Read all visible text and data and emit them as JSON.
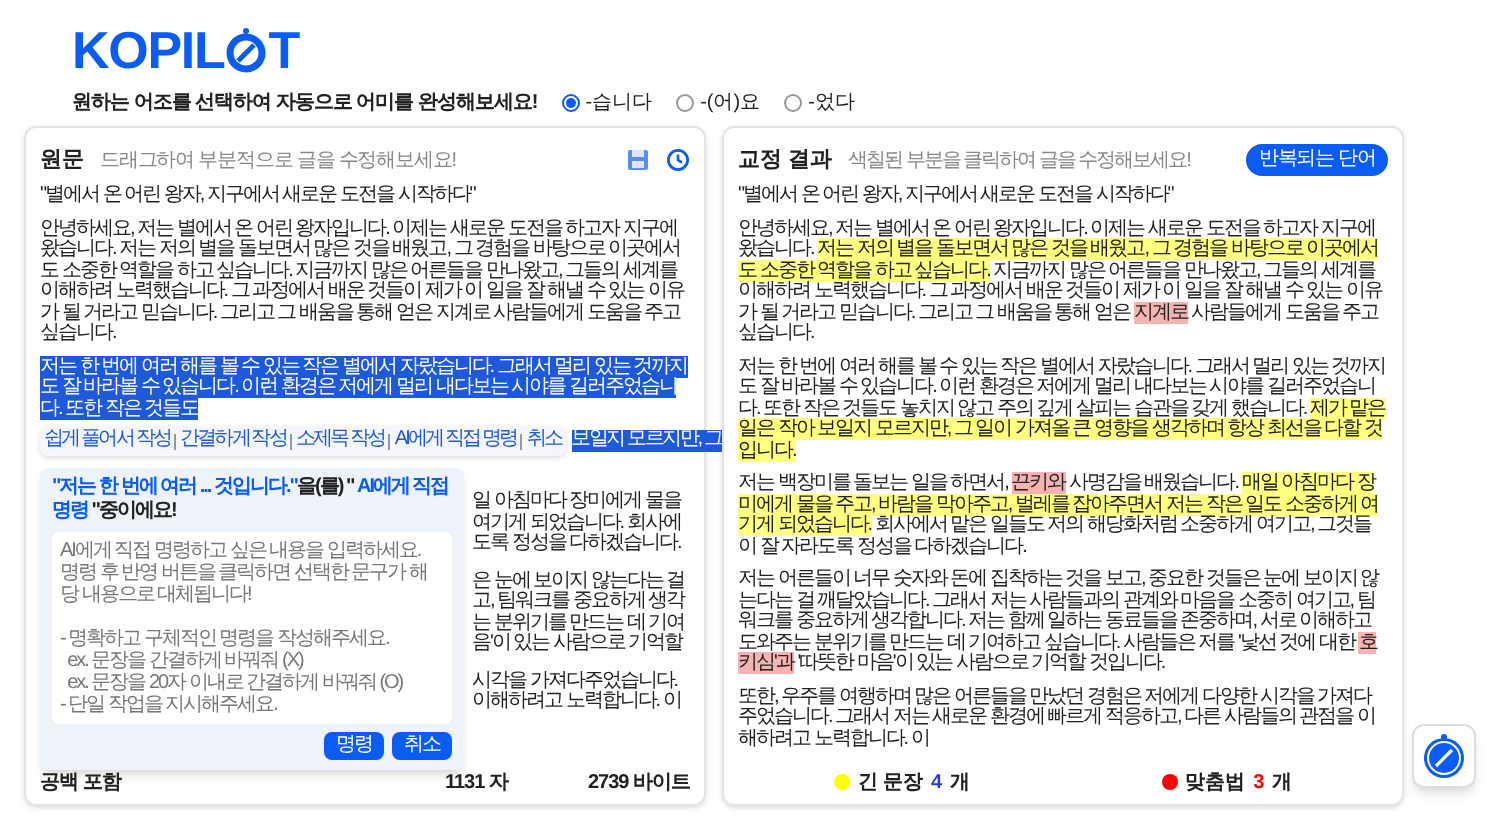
{
  "logo": {
    "before": "KOPIL",
    "after": "T"
  },
  "tone": {
    "prompt": "원하는 어조를 선택하여 자동으로 어미를 완성해보세요!",
    "options": [
      {
        "label": "-습니다",
        "selected": true
      },
      {
        "label": "-(어)요",
        "selected": false
      },
      {
        "label": "-었다",
        "selected": false
      }
    ]
  },
  "original": {
    "title": "원문",
    "hint": "드래그하여 부분적으로 글을 수정해보세요!",
    "paragraphs": [
      [
        {
          "kind": "plain",
          "text": "\"별에서 온 어린 왕자, 지구에서 새로운 도전을 시작하다\""
        }
      ],
      [
        {
          "kind": "plain",
          "text": "안녕하세요, 저는 별에서 온 어린 왕자입니다. 이제는 새로운 도전을 하고자 지구에 왔습니다. 저는 저의 별을 돌보면서 많은 것을 배웠고, 그 경험을 바탕으로 이곳에서도 소중한 역할을 하고 싶습니다. 지금까지 많은 어른들을 만나왔고, 그들의 세계를 이해하려 노력했습니다. 그 과정에서 배운 것들이 제가 이 일을 잘 해낼 수 있는 이유가 될 거라고 믿습니다. 그리고 그 배움을 통해 얻은 지계로 사람들에게 도움을 주고 싶습니다."
        }
      ],
      [
        {
          "kind": "selected",
          "text": "저는 한 번에 여러 해를 볼 수 있는 작은 별에서 자랐습니다. 그래서 멀리 있는 것까지도 잘 바라볼 수 있습니다. 이런 환경은 저에게 멀리 내다보는 시야를 길러주었습니다. 또한 작은 것들도"
        }
      ]
    ],
    "toolbar": [
      "쉽게 풀어서 작성",
      "간결하게 작성",
      "소제목 작성",
      "AI에게 직접 명령",
      "취소"
    ],
    "toolbar_side_text": "보일지 모르지만, 그",
    "side_fragments": [
      [
        "일 아침마다 장미에게 물을",
        "여기게 되었습니다. 회사에",
        "도록 정성을 다하겠습니다."
      ],
      [
        "은 눈에 보이지 않는다는 걸",
        "고, 팀워크를 중요하게 생각",
        "는 분위기를 만드는 데 기여",
        "음'이 있는 사람으로 기억할"
      ],
      [
        "시각을 가져다주었습니다.",
        "이해하려고 노력합니다. 이"
      ]
    ],
    "popup": {
      "title": [
        {
          "kind": "accent",
          "text": "\"저는 한 번에 여러 ... 것입니다.\""
        },
        {
          "kind": "plain",
          "text": "을(를) \""
        },
        {
          "kind": "accent",
          "text": " AI에게 직접 명령"
        },
        {
          "kind": "plain",
          "text": " \"중이에요!"
        }
      ],
      "placeholder": "AI에게 직접 명령하고 싶은 내용을 입력하세요.\n명령 후 반영 버튼을 클릭하면 선택한 문구가 해당 내용으로 대체됩니다!\n\n- 명확하고 구체적인 명령을 작성해주세요.\n  ex. 문장을 간결하게 바꿔줘 (X)\n  ex. 문장을 20자 이내로 간결하게 바꿔줘 (O)\n- 단일 작업을 지시해주세요.",
      "buttons": [
        "명령",
        "취소"
      ]
    },
    "footer": {
      "label": "공백 포함",
      "chars": "1131 자",
      "bytes": "2739 바이트"
    }
  },
  "result": {
    "title": "교정 결과",
    "hint": "색칠된 부분을 클릭하여 글을 수정해보세요!",
    "button": "반복되는 단어",
    "paragraphs": [
      [
        {
          "kind": "plain",
          "text": "\"별에서 온 어린 왕자, 지구에서 새로운 도전을 시작하다\""
        }
      ],
      [
        {
          "kind": "plain",
          "text": "안녕하세요, 저는 별에서 온 어린 왕자입니다. 이제는 새로운 도전을 하고자 지구에 왔습니다. "
        },
        {
          "kind": "long",
          "text": "저는 저의 별을 돌보면서 많은 것을 배웠고, 그 경험을 바탕으로 이곳에서도 소중한 역할을 하고 싶습니다."
        },
        {
          "kind": "plain",
          "text": " 지금까지 많은 어른들을 만나왔고, 그들의 세계를 이해하려 노력했습니다. 그 과정에서 배운 것들이 제가 이 일을 잘 해낼 수 있는 이유가 될 거라고 믿습니다. 그리고 그 배움을 통해 얻은 "
        },
        {
          "kind": "spelling",
          "text": "지계로"
        },
        {
          "kind": "plain",
          "text": " 사람들에게 도움을 주고 싶습니다."
        }
      ],
      [
        {
          "kind": "plain",
          "text": "저는 한 번에 여러 해를 볼 수 있는 작은 별에서 자랐습니다. 그래서 멀리 있는 것까지도 잘 바라볼 수 있습니다. 이런 환경은 저에게 멀리 내다보는 시야를 길러주었습니다. 또한 작은 것들도 놓치지 않고 주의 깊게 살피는 습관을 갖게 했습니다. "
        },
        {
          "kind": "long",
          "text": "제가 맡은 일은 작아 보일지 모르지만, 그 일이 가져올 큰 영향을 생각하며 항상 최선을 다할 것입니다."
        }
      ],
      [
        {
          "kind": "plain",
          "text": "저는 백장미를 돌보는 일을 하면서, "
        },
        {
          "kind": "spelling",
          "text": "끈키와"
        },
        {
          "kind": "plain",
          "text": " 사명감을 배웠습니다. "
        },
        {
          "kind": "long",
          "text": "매일 아침마다 장미에게 물을 주고, 바람을 막아주고, 벌레를 잡아주면서 저는 작은 일도 소중하게 여기게 되었습니다."
        },
        {
          "kind": "plain",
          "text": " 회사에서 맡은 일들도 저의 해당화처럼 소중하게 여기고, 그것들이 잘 자라도록 정성을 다하겠습니다."
        }
      ],
      [
        {
          "kind": "plain",
          "text": "저는 어른들이 너무 숫자와 돈에 집착하는 것을 보고, 중요한 것들은 눈에 보이지 않는다는 걸 깨달았습니다. 그래서 저는 사람들과의 관계와 마음을 소중히 여기고, 팀워크를 중요하게 생각합니다. 저는 함께 일하는 동료들을 존중하며, 서로 이해하고 도와주는 분위기를 만드는 데 기여하고 싶습니다. 사람들은 저를 '낯선 것에 대한 "
        },
        {
          "kind": "spelling",
          "text": "호키심'과"
        },
        {
          "kind": "plain",
          "text": " '따뜻한 마음'이 있는 사람으로 기억할 것입니다."
        }
      ],
      [
        {
          "kind": "plain",
          "text": "또한, 우주를 여행하며 많은 어른들을 만났던 경험은 저에게 다양한 시각을 가져다주었습니다. 그래서 저는 새로운 환경에 빠르게 적응하고, 다른 사람들의 관점을 이해하려고 노력합니다. 이"
        }
      ]
    ],
    "legend": [
      {
        "label": "긴 문장",
        "count": "4",
        "unit": "개",
        "color": "#ffff00"
      },
      {
        "label": "맞춤법",
        "count": "3",
        "unit": "개",
        "color": "#ff0000"
      }
    ]
  }
}
